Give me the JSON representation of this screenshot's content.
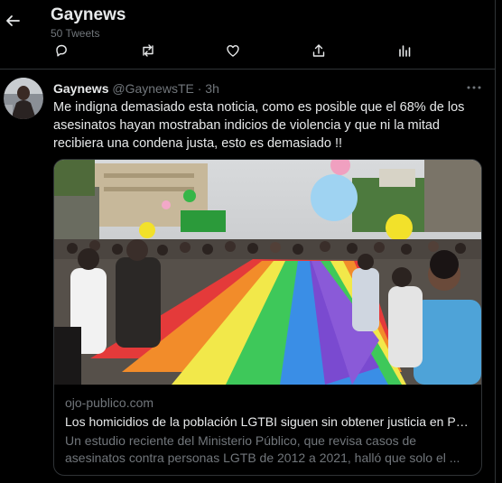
{
  "header": {
    "title": "Gaynews",
    "tweet_count": "50 Tweets",
    "back_icon": "arrow-left-icon"
  },
  "actions": [
    "reply-icon",
    "retweet-icon",
    "like-icon",
    "share-icon",
    "analytics-icon"
  ],
  "tweet": {
    "name": "Gaynews",
    "handle": "@GaynewsTE",
    "separator": "·",
    "time": "3h",
    "text": "Me indigna demasiado esta noticia, como es posible que el 68% de los asesinatos hayan mostraban indicios de violencia y que ni la mitad recibiera una condena justa, esto es demasiado !!"
  },
  "card": {
    "domain": "ojo-publico.com",
    "title": "Los homicidios de la población LGTBI siguen sin obtener justicia en Pe...",
    "description": "Un estudio reciente del Ministerio Público, que revisa casos de asesinatos contra personas LGTB de 2012 a 2021, halló que solo el ..."
  },
  "colors": {
    "background": "#000000",
    "text": "#e7e9ea",
    "secondary": "#71767b",
    "border": "#2f3336"
  }
}
